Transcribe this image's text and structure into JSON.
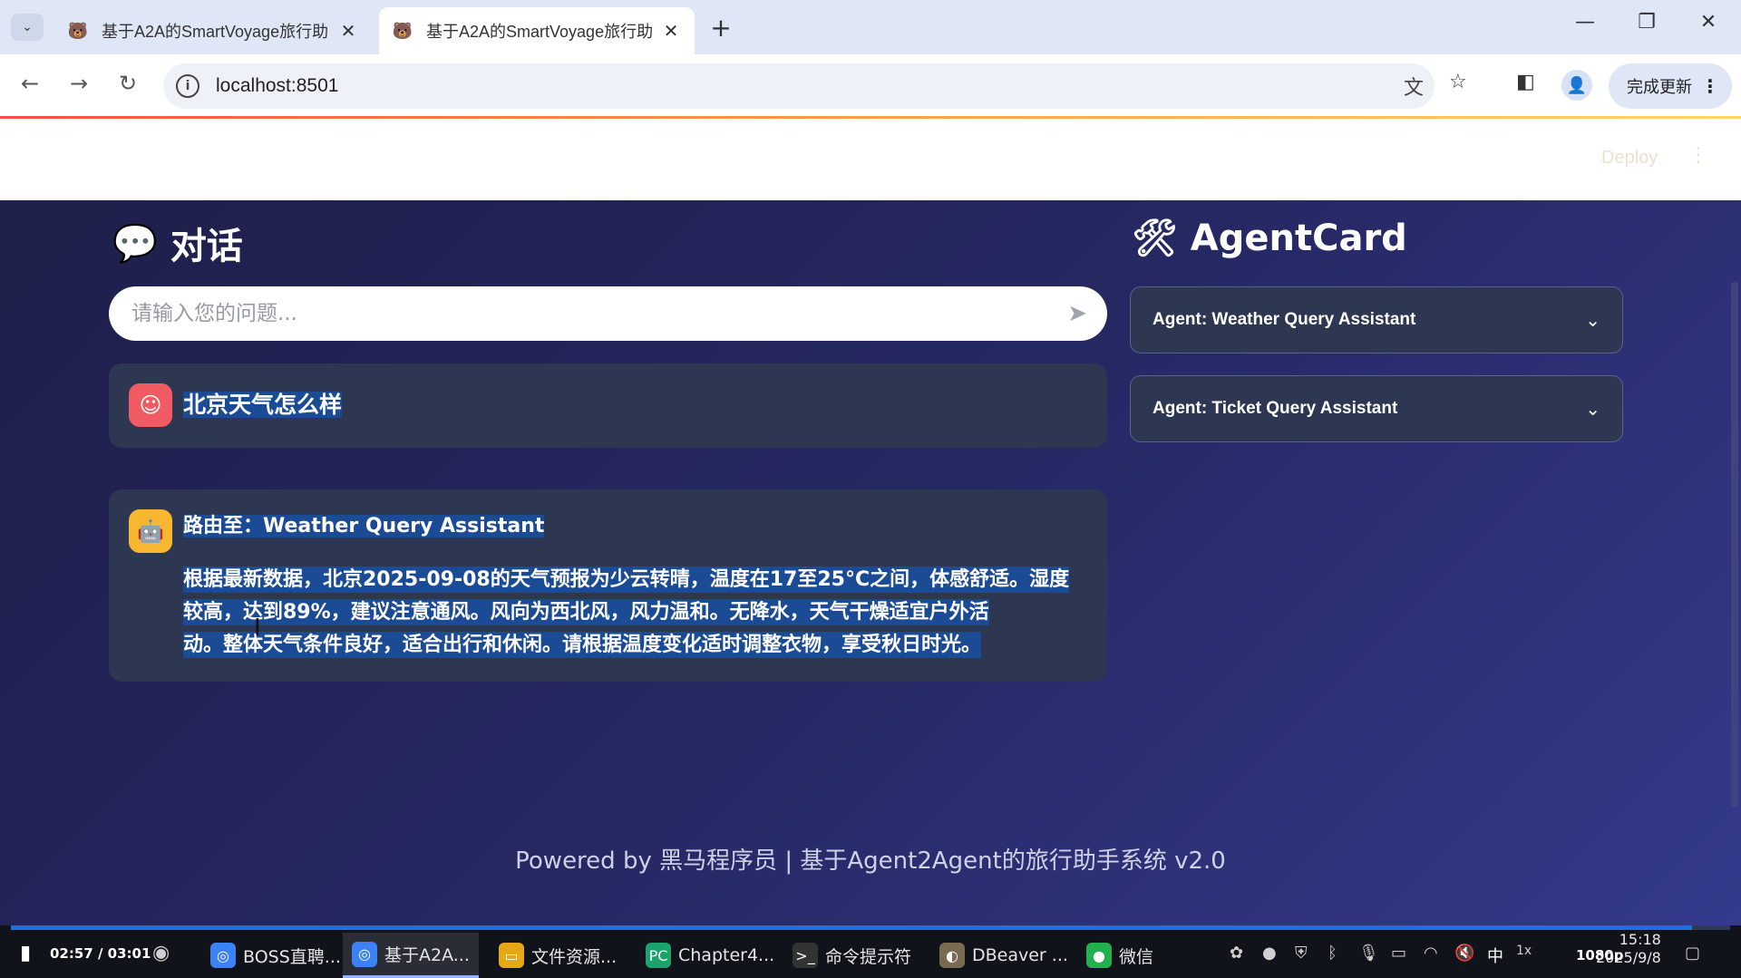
{
  "browser": {
    "tabs": [
      {
        "title": "基于A2A的SmartVoyage旅行助",
        "active": false
      },
      {
        "title": "基于A2A的SmartVoyage旅行助",
        "active": true
      }
    ],
    "url": "localhost:8501",
    "update_label": "完成更新"
  },
  "header": {
    "deploy_label": "Deploy"
  },
  "chat": {
    "section_title": "对话",
    "input_placeholder": "请输入您的问题...",
    "user_message": "北京天气怎么样",
    "route_label": "路由至：Weather Query Assistant",
    "answer_lines": [
      "根据最新数据，北京2025-09-08的天气预报为少云转晴，温度在17至25°C之间，体感舒适。湿度",
      "较高，达到89%，建议注意通风。风向为西北风，风力温和。无降水，天气干燥适宜户外活",
      "动。整体天气条件良好，适合出行和休闲。请根据温度变化适时调整衣物，享受秋日时光。"
    ]
  },
  "agent_card": {
    "section_title": "AgentCard",
    "agents": [
      {
        "label": "Agent: Weather Query Assistant"
      },
      {
        "label": "Agent: Ticket Query Assistant"
      }
    ]
  },
  "footer": {
    "text": "Powered by 黑马程序员 | 基于Agent2Agent的旅行助手系统 v2.0"
  },
  "taskbar": {
    "video_time": "02:57 / 03:01",
    "video_progress": 0.978,
    "apps": [
      {
        "label": "BOSS直聘...",
        "icon": "chrome-icon"
      },
      {
        "label": "基于A2A...",
        "icon": "chrome-icon",
        "active": true
      },
      {
        "label": "文件资源...",
        "icon": "folder-icon"
      },
      {
        "label": "Chapter4...",
        "icon": "pycharm-icon"
      },
      {
        "label": "命令提示符",
        "icon": "terminal-icon"
      },
      {
        "label": "DBeaver ...",
        "icon": "dbeaver-icon"
      },
      {
        "label": "微信",
        "icon": "wechat-icon"
      }
    ],
    "ime": "中",
    "quality": "1080p",
    "time": "15:18",
    "date": "2025/9/8"
  }
}
